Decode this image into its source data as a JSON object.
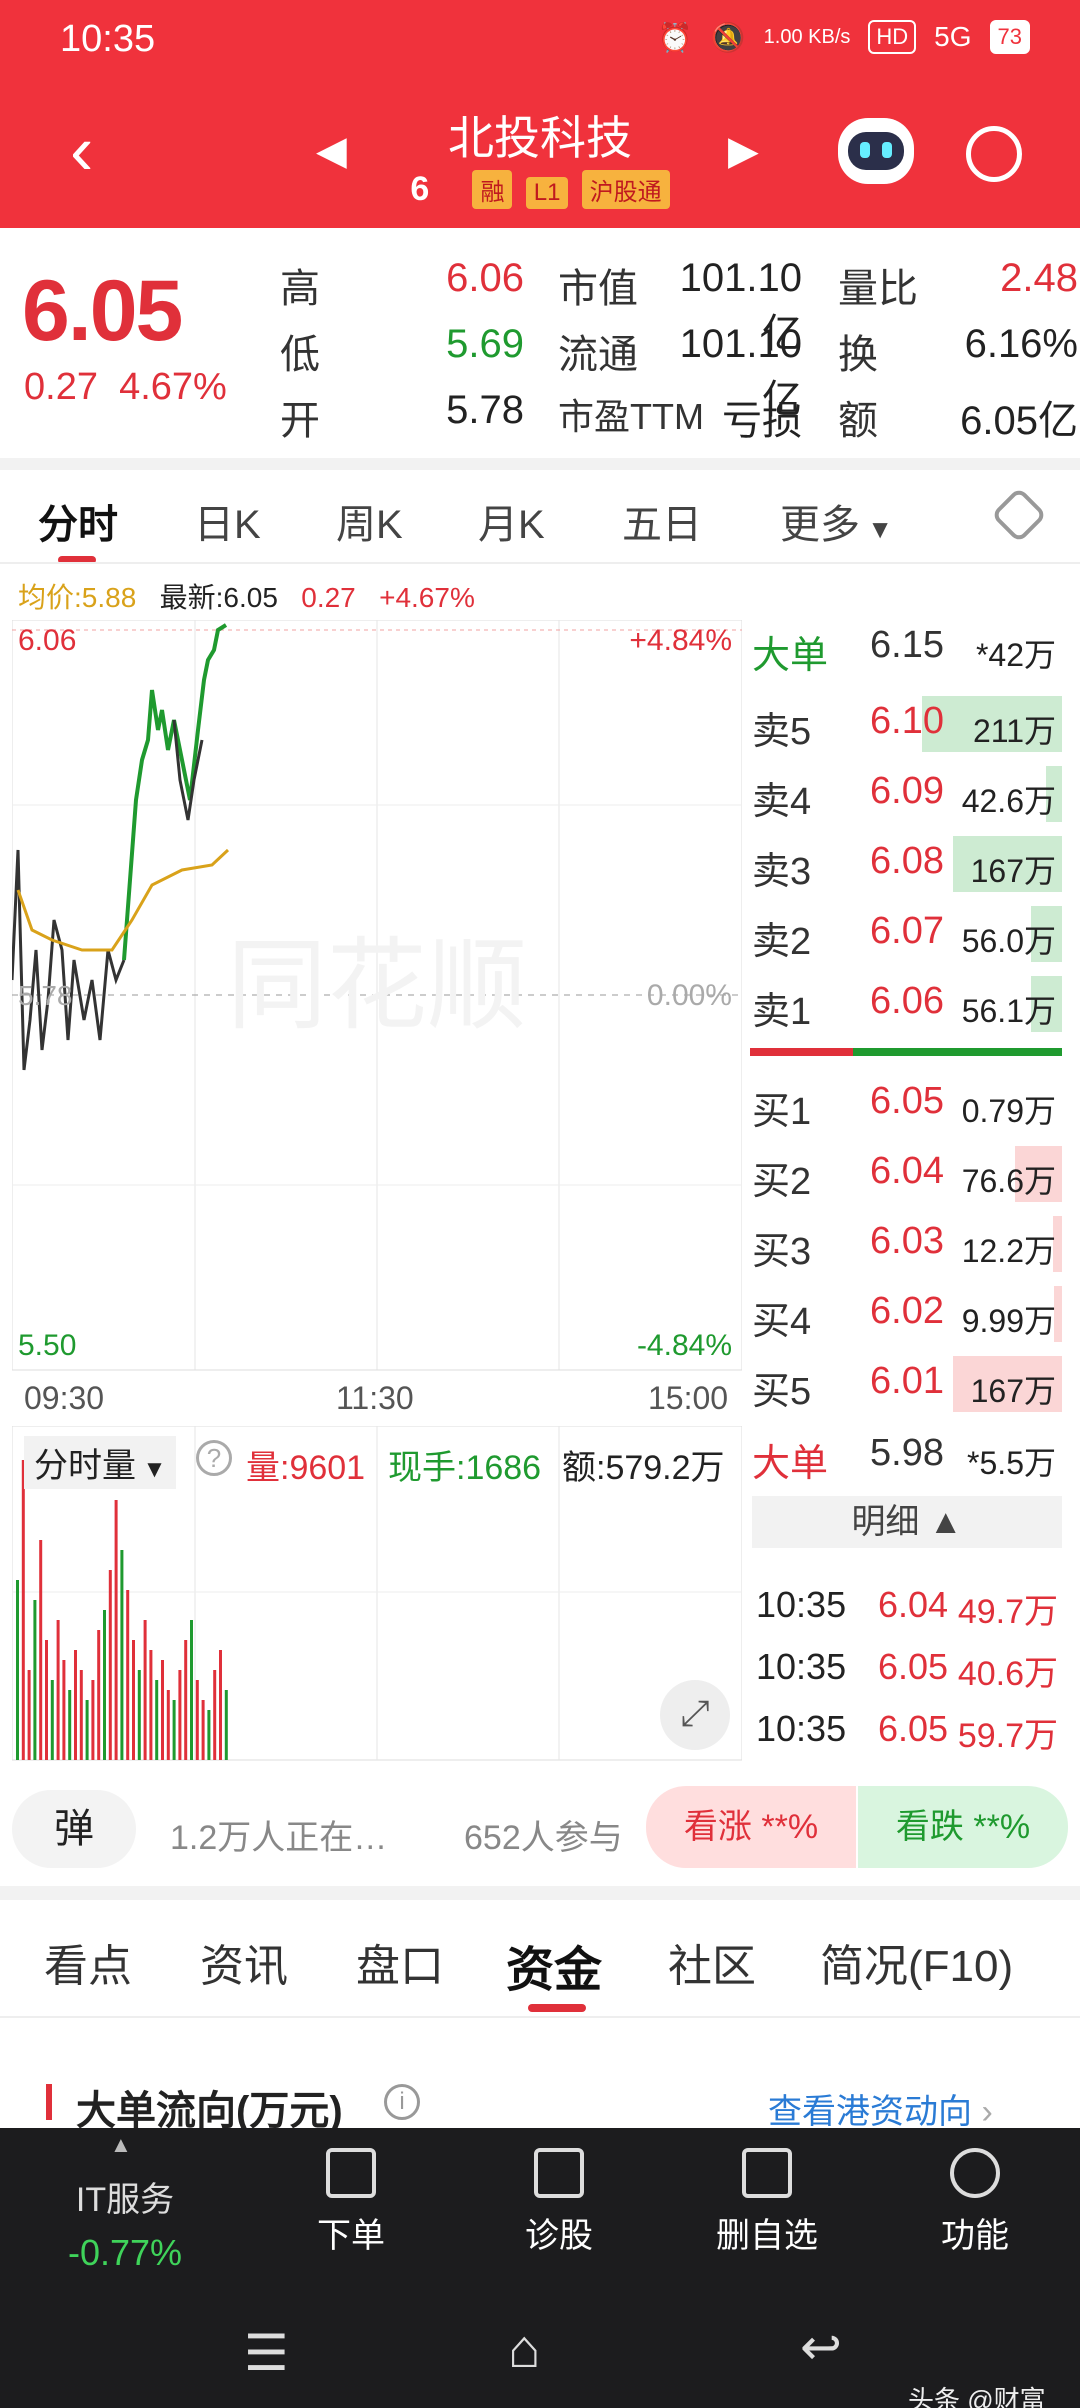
{
  "status": {
    "time": "10:35",
    "net_speed": "1.00 KB/s",
    "signal": "5G",
    "battery": "73"
  },
  "header": {
    "stock_name": "北投科技",
    "stock_code_suffix": "6",
    "tags": [
      "融",
      "L1",
      "沪股通"
    ]
  },
  "quote": {
    "price": "6.05",
    "change": "0.27",
    "change_pct": "4.67%",
    "labels": {
      "high": "高",
      "low": "低",
      "open": "开",
      "mktcap": "市值",
      "float": "流通",
      "pe": "市盈TTM",
      "vol_ratio": "量比",
      "turnover": "换",
      "amount": "额"
    },
    "high": "6.06",
    "low": "5.69",
    "open": "5.78",
    "mktcap": "101.10亿",
    "float": "101.10亿",
    "pe": "亏损",
    "vol_ratio": "2.48",
    "turnover": "6.16%",
    "amount": "6.05亿"
  },
  "chart_tabs": [
    "分时",
    "日K",
    "周K",
    "月K",
    "五日",
    "更多"
  ],
  "chart_info": {
    "avg_label": "均价:5.88",
    "latest_label": "最新:6.05",
    "chg": "0.27",
    "chg_pct": "+4.67%"
  },
  "chart_axes": {
    "top_price": "6.06",
    "mid_price": "5.78",
    "bottom_price": "5.50",
    "top_pct": "+4.84%",
    "mid_pct": "0.00%",
    "bottom_pct": "-4.84%",
    "times": [
      "09:30",
      "11:30",
      "15:00"
    ],
    "watermark": "同花顺"
  },
  "volume": {
    "label": "分时量",
    "vol": "量:9601",
    "hand": "现手:1686",
    "amount": "额:579.2万"
  },
  "orderbook": {
    "big_sell": {
      "label": "大单",
      "price": "6.15",
      "qty": "*42万"
    },
    "asks": [
      {
        "label": "卖5",
        "price": "6.10",
        "qty": "211万",
        "fill": 0.45
      },
      {
        "label": "卖4",
        "price": "6.09",
        "qty": "42.6万",
        "fill": 0.05
      },
      {
        "label": "卖3",
        "price": "6.08",
        "qty": "167万",
        "fill": 0.35
      },
      {
        "label": "卖2",
        "price": "6.07",
        "qty": "56.0万",
        "fill": 0.1
      },
      {
        "label": "卖1",
        "price": "6.06",
        "qty": "56.1万",
        "fill": 0.1
      }
    ],
    "bids": [
      {
        "label": "买1",
        "price": "6.05",
        "qty": "0.79万",
        "fill": 0.0
      },
      {
        "label": "买2",
        "price": "6.04",
        "qty": "76.6万",
        "fill": 0.15
      },
      {
        "label": "买3",
        "price": "6.03",
        "qty": "12.2万",
        "fill": 0.03
      },
      {
        "label": "买4",
        "price": "6.02",
        "qty": "9.99万",
        "fill": 0.02
      },
      {
        "label": "买5",
        "price": "6.01",
        "qty": "167万",
        "fill": 0.35
      }
    ],
    "big_buy": {
      "label": "大单",
      "price": "5.98",
      "qty": "*5.5万"
    },
    "detail_label": "明细",
    "trades": [
      {
        "time": "10:35",
        "price": "6.04",
        "qty": "49.7万"
      },
      {
        "time": "10:35",
        "price": "6.05",
        "qty": "40.6万"
      },
      {
        "time": "10:35",
        "price": "6.05",
        "qty": "59.7万"
      }
    ]
  },
  "barrage": {
    "label": "弹",
    "text1": "1.2万人正在…",
    "text2": "652人参与",
    "up": "看涨 **%",
    "down": "看跌 **%"
  },
  "section_tabs": [
    "看点",
    "资讯",
    "盘口",
    "资金",
    "社区",
    "简况(F10)"
  ],
  "section": {
    "title": "大单流向(万元)",
    "link": "查看港资动向"
  },
  "bottom": {
    "sector": "IT服务",
    "sector_chg": "-0.77%",
    "items": [
      "下单",
      "诊股",
      "删自选",
      "功能"
    ]
  },
  "watermark": "头条 @财富"
}
